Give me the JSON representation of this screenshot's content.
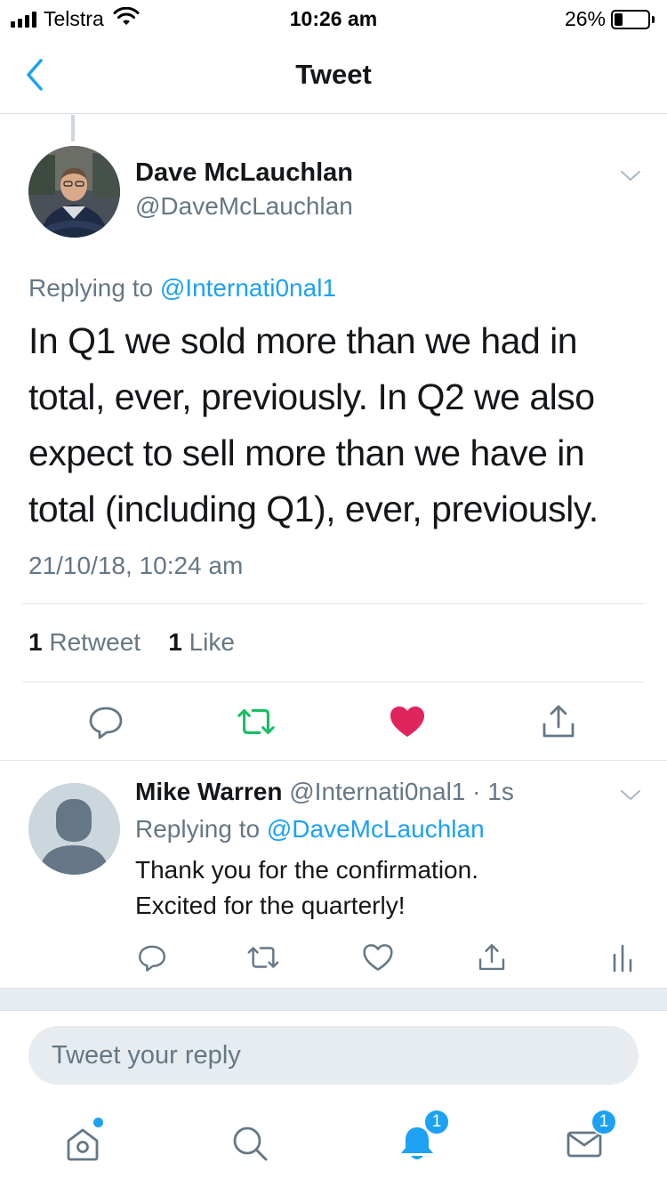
{
  "status_bar": {
    "carrier": "Telstra",
    "time": "10:26 am",
    "battery_percent": "26%",
    "battery_level": 0.26
  },
  "nav": {
    "title": "Tweet",
    "back_icon": "chevron-left-icon"
  },
  "main_tweet": {
    "author_name": "Dave McLauchlan",
    "author_handle": "@DaveMcLauchlan",
    "replying_prefix": "Replying to",
    "replying_to": "@Internati0nal1",
    "text": "In Q1 we sold more than we had in total, ever, previously. In Q2 we also expect to sell more than we have in total (including Q1), ever, previously.",
    "timestamp": "21/10/18, 10:24 am",
    "retweet_count": "1",
    "retweet_label": "Retweet",
    "like_count": "1",
    "like_label": "Like",
    "actions": [
      "reply-icon",
      "retweet-icon",
      "like-icon",
      "share-icon"
    ],
    "colors": {
      "retweet_active": "#17bf63",
      "like_active": "#e0245e"
    }
  },
  "reply_tweet": {
    "author_name": "Mike Warren",
    "author_handle": "@Internati0nal1",
    "separator": "·",
    "time_ago": "1s",
    "replying_prefix": "Replying to",
    "replying_to": "@DaveMcLauchlan",
    "text_line1": "Thank you for the confirmation.",
    "text_line2": "Excited for the quarterly!",
    "actions": [
      "reply-icon",
      "retweet-icon",
      "like-icon",
      "share-icon",
      "analytics-icon"
    ]
  },
  "reply_box": {
    "placeholder": "Tweet your reply"
  },
  "tab_bar": {
    "tabs": [
      "home-icon",
      "search-icon",
      "notifications-icon",
      "messages-icon"
    ],
    "notifications_badge": "1",
    "messages_badge": "1",
    "accent": "#1da1f2"
  }
}
